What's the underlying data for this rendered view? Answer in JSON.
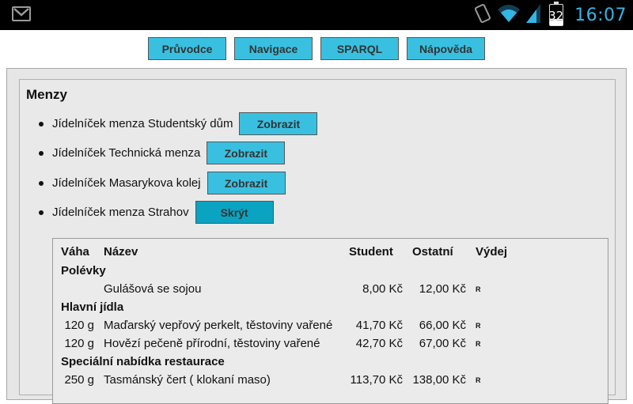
{
  "status": {
    "time": "16:07",
    "battery": "32",
    "icons": [
      "gmail-icon",
      "vibrate-icon",
      "wifi-icon",
      "signal-icon",
      "battery-icon"
    ],
    "accent": "#33b5e5"
  },
  "nav": {
    "buttons": [
      "Průvodce",
      "Navigace",
      "SPARQL",
      "Nápověda"
    ]
  },
  "menzy": {
    "title": "Menzy",
    "items": [
      {
        "label": "Jídelníček menza Studentský dům",
        "button": "Zobrazit"
      },
      {
        "label": "Jídelníček Technická menza",
        "button": "Zobrazit"
      },
      {
        "label": "Jídelníček Masarykova kolej",
        "button": "Zobrazit"
      },
      {
        "label": "Jídelníček menza Strahov",
        "button": "Skrýt"
      }
    ]
  },
  "table": {
    "headers": [
      "Váha",
      "Název",
      "Student",
      "Ostatní",
      "Výdej"
    ],
    "sections": [
      {
        "category": "Polévky",
        "rows": [
          {
            "weight": "",
            "name": "Gulášová se sojou",
            "student": "8,00 Kč",
            "other": "12,00 Kč",
            "vydej": "R"
          }
        ]
      },
      {
        "category": "Hlavní jídla",
        "rows": [
          {
            "weight": "120 g",
            "name": "Maďarský vepřový perkelt, těstoviny vařené",
            "student": "41,70 Kč",
            "other": "66,00 Kč",
            "vydej": "R"
          },
          {
            "weight": "120 g",
            "name": "Hovězí pečeně přírodní, těstoviny vařené",
            "student": "42,70 Kč",
            "other": "67,00 Kč",
            "vydej": "R"
          }
        ]
      },
      {
        "category": "Speciální nabídka restaurace",
        "rows": [
          {
            "weight": "250 g",
            "name": "Tasmánský čert ( klokaní maso)",
            "student": "113,70 Kč",
            "other": "138,00 Kč",
            "vydej": "R"
          }
        ]
      }
    ]
  },
  "colors": {
    "button": "#39c0e0",
    "button_active": "#0aa3c2",
    "panel": "#e6e6e6"
  }
}
